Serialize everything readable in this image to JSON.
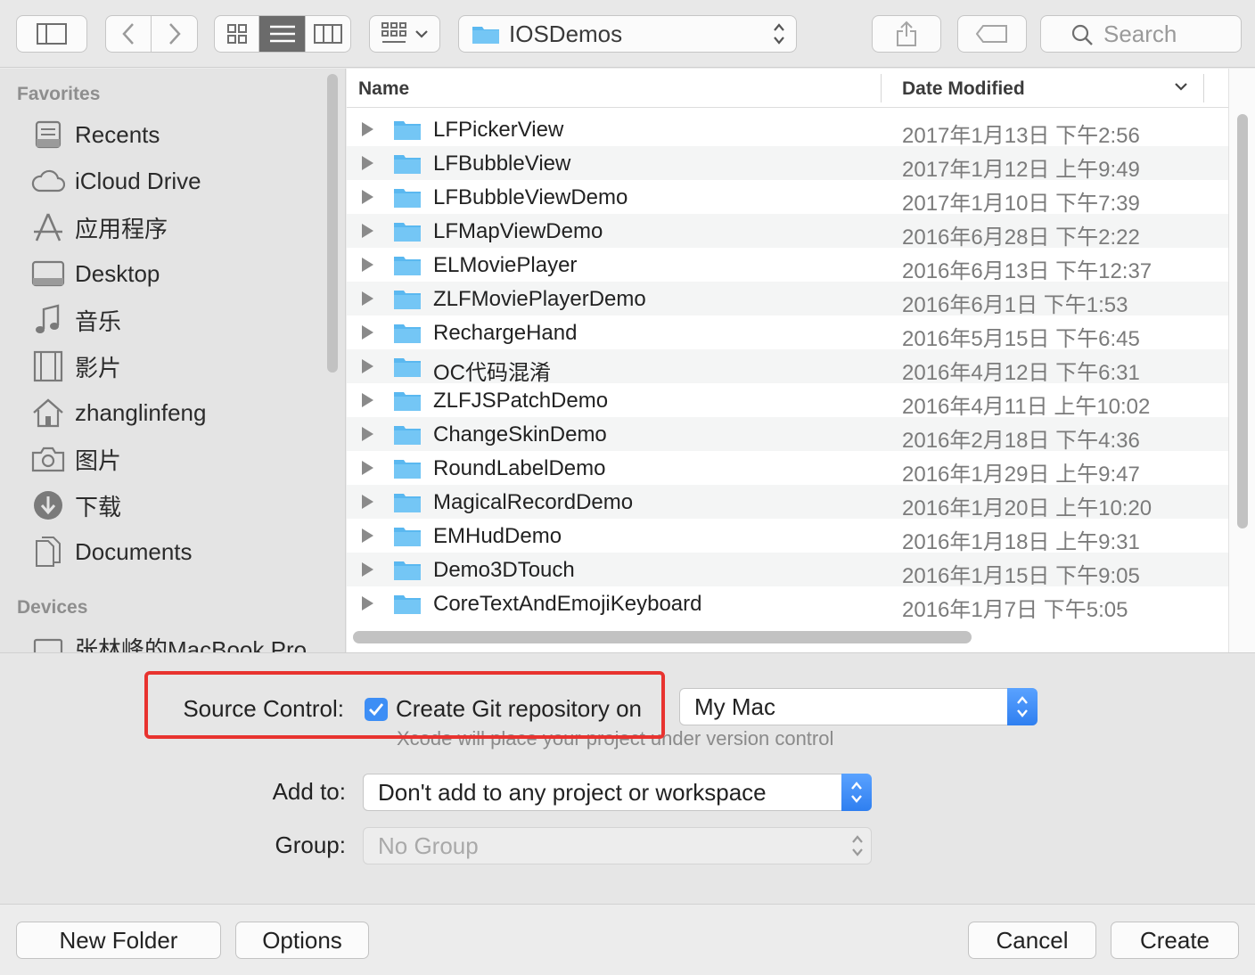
{
  "toolbar": {
    "path_label": "IOSDemos",
    "search_placeholder": "Search"
  },
  "sidebar": {
    "favorites_heading": "Favorites",
    "favorites": [
      {
        "label": "Recents",
        "icon": "recents-icon"
      },
      {
        "label": "iCloud Drive",
        "icon": "cloud-icon"
      },
      {
        "label": "应用程序",
        "icon": "applications-icon"
      },
      {
        "label": "Desktop",
        "icon": "desktop-icon"
      },
      {
        "label": "音乐",
        "icon": "music-icon"
      },
      {
        "label": "影片",
        "icon": "movies-icon"
      },
      {
        "label": "zhanglinfeng",
        "icon": "home-icon"
      },
      {
        "label": "图片",
        "icon": "camera-icon"
      },
      {
        "label": "下载",
        "icon": "download-icon"
      },
      {
        "label": "Documents",
        "icon": "documents-icon"
      }
    ],
    "devices_heading": "Devices",
    "devices": [
      {
        "label": "张林峰的MacBook Pro",
        "icon": "laptop-icon"
      }
    ]
  },
  "file_list": {
    "col_name": "Name",
    "col_date": "Date Modified",
    "rows": [
      {
        "name": "LFPickerView",
        "date": "2017年1月13日 下午2:56"
      },
      {
        "name": "LFBubbleView",
        "date": "2017年1月12日 上午9:49"
      },
      {
        "name": "LFBubbleViewDemo",
        "date": "2017年1月10日 下午7:39"
      },
      {
        "name": "LFMapViewDemo",
        "date": "2016年6月28日 下午2:22"
      },
      {
        "name": "ELMoviePlayer",
        "date": "2016年6月13日 下午12:37"
      },
      {
        "name": "ZLFMoviePlayerDemo",
        "date": "2016年6月1日 下午1:53"
      },
      {
        "name": "RechargeHand",
        "date": "2016年5月15日 下午6:45"
      },
      {
        "name": "OC代码混淆",
        "date": "2016年4月12日 下午6:31"
      },
      {
        "name": "ZLFJSPatchDemo",
        "date": "2016年4月11日 上午10:02"
      },
      {
        "name": "ChangeSkinDemo",
        "date": "2016年2月18日 下午4:36"
      },
      {
        "name": "RoundLabelDemo",
        "date": "2016年1月29日 上午9:47"
      },
      {
        "name": "MagicalRecordDemo",
        "date": "2016年1月20日 上午10:20"
      },
      {
        "name": "EMHudDemo",
        "date": "2016年1月18日 上午9:31"
      },
      {
        "name": "Demo3DTouch",
        "date": "2016年1月15日 下午9:05"
      },
      {
        "name": "CoreTextAndEmojiKeyboard",
        "date": "2016年1月7日 下午5:05"
      }
    ]
  },
  "options": {
    "source_control_label": "Source Control:",
    "git_checkbox_label": "Create Git repository on",
    "git_checked": true,
    "git_target": "My Mac",
    "git_hint": "Xcode will place your project under version control",
    "add_to_label": "Add to:",
    "add_to_value": "Don't add to any project or workspace",
    "group_label": "Group:",
    "group_value": "No Group"
  },
  "buttons": {
    "new_folder": "New Folder",
    "options": "Options",
    "cancel": "Cancel",
    "create": "Create"
  },
  "colors": {
    "accent": "#3d8ef5",
    "highlight_border": "#e8332f",
    "folder": "#5ab8f0"
  }
}
